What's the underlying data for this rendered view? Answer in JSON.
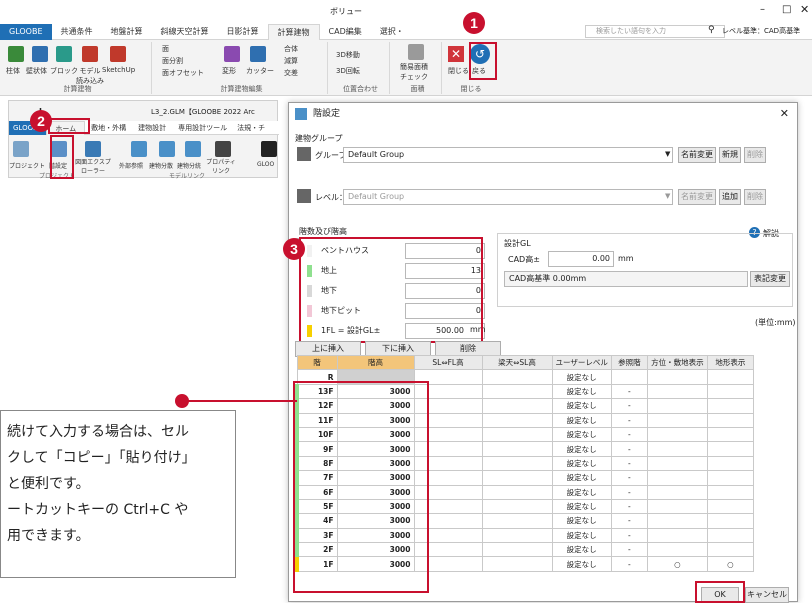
{
  "ribbon": {
    "title": "ボリュー",
    "tabs": [
      "GLOOBE",
      "共通条件",
      "地盤計算",
      "斜線天空計算",
      "日影計算",
      "計算建物",
      "CAD編集",
      "選択・"
    ],
    "search_placeholder": "検索したい語句を入力",
    "level_label": "レベル基準：CAD高基準",
    "groups": {
      "bldg": "計算建物",
      "edit": "計算建物編集",
      "pos": "位置合わせ",
      "area": "面積",
      "close": "閉じる"
    },
    "buttons": {
      "pillar": "柱体",
      "wall": "壁状体",
      "block": "ブロック",
      "model": "モデル\n読み込み",
      "sketchup": "SketchUp",
      "face": "面",
      "facediv": "面分割",
      "faceoffset": "面オフセット",
      "deform": "変形",
      "cutter": "カッター",
      "union": "合体",
      "subtract": "減算",
      "intersect": "交差",
      "move3d": "3D移動",
      "rotate3d": "3D回転",
      "check": "簡易面積\nチェック",
      "close": "閉じる",
      "back": "戻る"
    }
  },
  "app2": {
    "title": "L3_2.GLM【GLOOBE 2022 Arc",
    "tabs": [
      "GLOOBE",
      "ホーム",
      "敷地・外構",
      "建物設計",
      "専用設計ツール",
      "法規・チ"
    ],
    "buttons": [
      "プロジェクト",
      "階設定",
      "図面エクスプローラー",
      "外部参照",
      "建物分散",
      "建物分統",
      "プロパティリンク",
      "GLOO"
    ],
    "groups": [
      "プロジェクト",
      "モデルリンク"
    ]
  },
  "dialog": {
    "title": "階設定",
    "group_section": "建物グループ",
    "group_label": "グループ:",
    "group_value": "Default Group",
    "rename": "名前変更",
    "new": "新規",
    "delete": "削除",
    "level_label": "レベル：",
    "level_value": "Default Group",
    "level_rename": "名前変更",
    "add": "追加",
    "level_delete": "削除",
    "help": "解説",
    "floors_title": "階数及び階高",
    "levels": [
      {
        "name": "ペントハウス",
        "value": "0",
        "color": "#ffffff"
      },
      {
        "name": "地上",
        "value": "13",
        "color": "#8fe08f"
      },
      {
        "name": "地下",
        "value": "0",
        "color": "#d8d8d8"
      },
      {
        "name": "地下ピット",
        "value": "0",
        "color": "#f2c7d6"
      },
      {
        "name": "1FL = 設計GL±",
        "value": "500.00",
        "unit": "mm",
        "color": "#f7d000"
      }
    ],
    "gl_title": "設計GL",
    "cad_label": "CAD高±",
    "cad_value": "0.00",
    "cad_unit": "mm",
    "cad_base": "CAD高基準 0.00mm",
    "display_change": "表記変更",
    "unit_note": "(単位:mm)",
    "insert_above": "上に挿入",
    "insert_below": "下に挿入",
    "remove": "削除",
    "table_headers": [
      "階",
      "階高",
      "SL⇔FL高",
      "梁天⇔SL高",
      "ユーザーレベル",
      "参照階",
      "方位・敷地表示",
      "地形表示"
    ],
    "rows": [
      {
        "floor": "R",
        "height": "",
        "user": "設定なし",
        "ref": "",
        "ori": "",
        "ter": ""
      },
      {
        "floor": "13F",
        "height": "3000",
        "user": "設定なし",
        "ref": "-",
        "ori": "",
        "ter": ""
      },
      {
        "floor": "12F",
        "height": "3000",
        "user": "設定なし",
        "ref": "-",
        "ori": "",
        "ter": ""
      },
      {
        "floor": "11F",
        "height": "3000",
        "user": "設定なし",
        "ref": "-",
        "ori": "",
        "ter": ""
      },
      {
        "floor": "10F",
        "height": "3000",
        "user": "設定なし",
        "ref": "-",
        "ori": "",
        "ter": ""
      },
      {
        "floor": "9F",
        "height": "3000",
        "user": "設定なし",
        "ref": "-",
        "ori": "",
        "ter": ""
      },
      {
        "floor": "8F",
        "height": "3000",
        "user": "設定なし",
        "ref": "-",
        "ori": "",
        "ter": ""
      },
      {
        "floor": "7F",
        "height": "3000",
        "user": "設定なし",
        "ref": "-",
        "ori": "",
        "ter": ""
      },
      {
        "floor": "6F",
        "height": "3000",
        "user": "設定なし",
        "ref": "-",
        "ori": "",
        "ter": ""
      },
      {
        "floor": "5F",
        "height": "3000",
        "user": "設定なし",
        "ref": "-",
        "ori": "",
        "ter": ""
      },
      {
        "floor": "4F",
        "height": "3000",
        "user": "設定なし",
        "ref": "-",
        "ori": "",
        "ter": ""
      },
      {
        "floor": "3F",
        "height": "3000",
        "user": "設定なし",
        "ref": "-",
        "ori": "",
        "ter": ""
      },
      {
        "floor": "2F",
        "height": "3000",
        "user": "設定なし",
        "ref": "-",
        "ori": "",
        "ter": ""
      },
      {
        "floor": "1F",
        "height": "3000",
        "user": "設定なし",
        "ref": "-",
        "ori": "○",
        "ter": "○"
      }
    ],
    "ok": "OK",
    "cancel": "キャンセル"
  },
  "callouts": [
    "1",
    "2",
    "3"
  ],
  "note": {
    "lines": [
      "続けて入力する場合は、セル",
      "クして「コピー」「貼り付け」",
      "と便利です。",
      "ートカットキーの Ctrl+C や",
      "用できます。"
    ]
  }
}
